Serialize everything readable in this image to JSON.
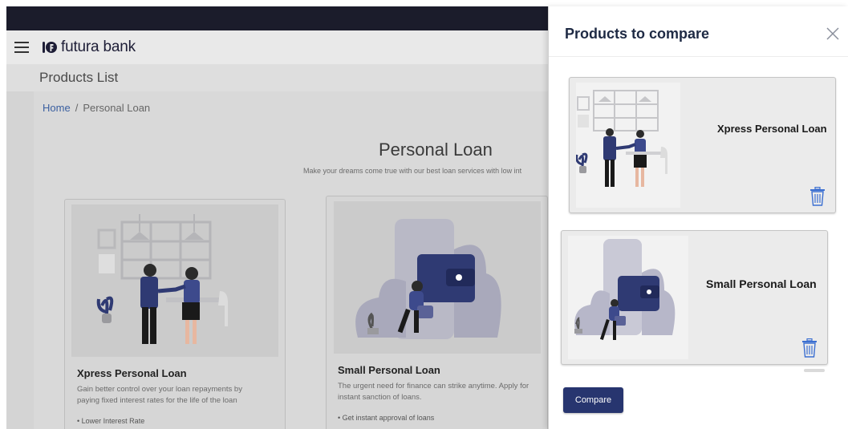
{
  "header": {
    "brand": "futura bank"
  },
  "subheader": {
    "title": "Products List"
  },
  "breadcrumb": {
    "home": "Home",
    "separator": "/",
    "current": "Personal Loan"
  },
  "page": {
    "heading": "Personal Loan",
    "subheading": "Make your dreams come true with our best loan services with low int"
  },
  "products": [
    {
      "title": "Xpress Personal Loan",
      "description": "Gain better control over your loan repayments by paying fixed interest rates for the life of the loan",
      "bullet": "Lower Interest Rate"
    },
    {
      "title": "Small Personal Loan",
      "description": "The urgent need for finance can strike anytime. Apply for instant sanction of loans.",
      "bullet": "Get instant approval of loans"
    }
  ],
  "compare_panel": {
    "title": "Products to compare",
    "items": [
      {
        "title": "Xpress Personal Loan"
      },
      {
        "title": "Small Personal Loan"
      }
    ],
    "compare_label": "Compare"
  },
  "colors": {
    "topbar": "#1b1c2b",
    "brand_navy": "#27356f",
    "link_blue": "#3a5fa0",
    "illustration_navy": "#2f3a73",
    "trash_icon": "#3b6fd1"
  },
  "icons": [
    "hamburger-menu-icon",
    "futura-bank-logo-icon",
    "close-icon",
    "trash-icon"
  ]
}
